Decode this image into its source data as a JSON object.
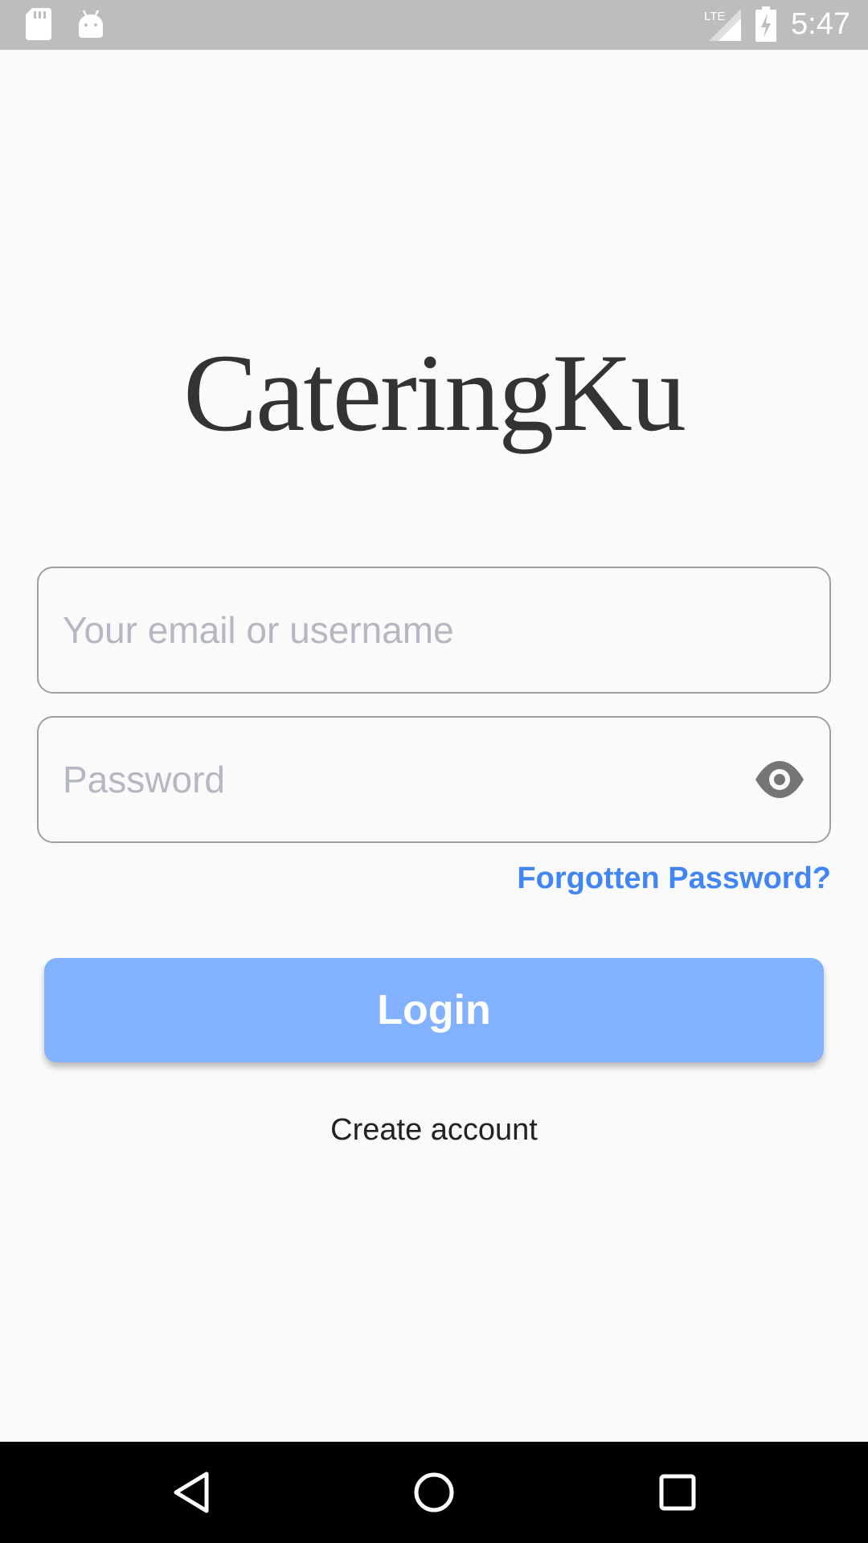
{
  "status_bar": {
    "time": "5:47",
    "network": "LTE",
    "icons": [
      "sd-card-icon",
      "android-icon",
      "lte-signal-icon",
      "battery-charging-icon"
    ]
  },
  "app": {
    "title": "CateringKu"
  },
  "form": {
    "email_placeholder": "Your email or username",
    "email_value": "",
    "password_placeholder": "Password",
    "password_value": "",
    "toggle_icon": "eye-icon",
    "forgot_label": "Forgotten Password?",
    "login_label": "Login",
    "create_account_label": "Create account"
  },
  "nav_bar": {
    "icons": [
      "back-icon",
      "home-icon",
      "recents-icon"
    ]
  },
  "colors": {
    "accent": "#4285f4",
    "button": "#82b1ff",
    "status_bar": "#bdbdbd",
    "background": "#fafafa"
  }
}
